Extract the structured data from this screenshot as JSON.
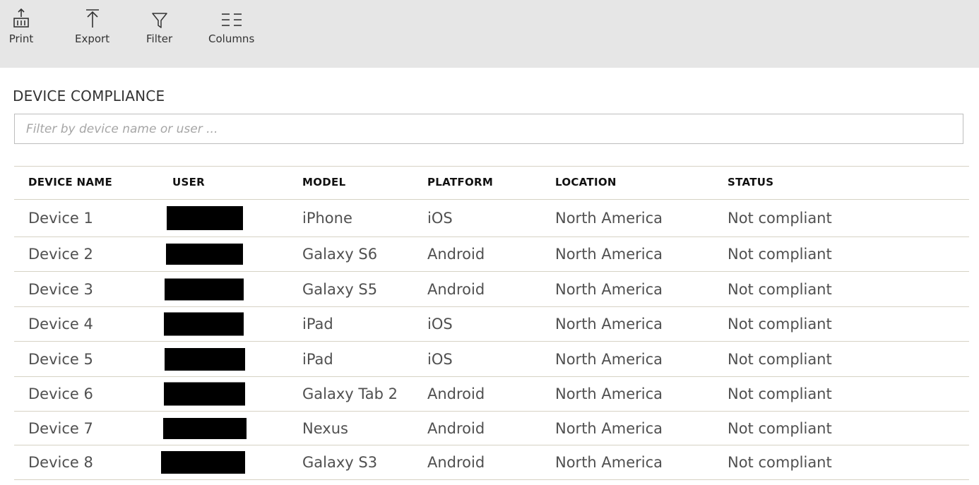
{
  "toolbar": {
    "print_label": "Print",
    "export_label": "Export",
    "filter_label": "Filter",
    "columns_label": "Columns"
  },
  "page": {
    "title": "DEVICE COMPLIANCE"
  },
  "search": {
    "placeholder": "Filter by device name or user ...",
    "value": ""
  },
  "table": {
    "headers": [
      "DEVICE NAME",
      "USER",
      "MODEL",
      "PLATFORM",
      "LOCATION",
      "STATUS"
    ],
    "rows": [
      {
        "device": "Device 1",
        "user": "",
        "model": "iPhone",
        "platform": "iOS",
        "location": "North America",
        "status": "Not compliant"
      },
      {
        "device": "Device 2",
        "user": "",
        "model": "Galaxy S6",
        "platform": "Android",
        "location": "North America",
        "status": "Not compliant"
      },
      {
        "device": "Device 3",
        "user": "",
        "model": "Galaxy S5",
        "platform": "Android",
        "location": "North America",
        "status": "Not compliant"
      },
      {
        "device": "Device 4",
        "user": "",
        "model": "iPad",
        "platform": "iOS",
        "location": "North America",
        "status": "Not compliant"
      },
      {
        "device": "Device 5",
        "user": "",
        "model": "iPad",
        "platform": "iOS",
        "location": "North America",
        "status": "Not compliant"
      },
      {
        "device": "Device 6",
        "user": "",
        "model": "Galaxy Tab 2",
        "platform": "Android",
        "location": "North America",
        "status": "Not compliant"
      },
      {
        "device": "Device 7",
        "user": "",
        "model": "Nexus",
        "platform": "Android",
        "location": "North America",
        "status": "Not compliant"
      },
      {
        "device": "Device 8",
        "user": "",
        "model": "Galaxy S3",
        "platform": "Android",
        "location": "North America",
        "status": "Not compliant"
      }
    ]
  },
  "icons": {
    "print": "printer-icon",
    "export": "export-arrow-icon",
    "filter": "funnel-icon",
    "columns": "columns-icon"
  },
  "colors": {
    "toolbar_bg": "#e6e6e6",
    "row_divider": "#d6d2c4",
    "redaction": "#000000"
  }
}
